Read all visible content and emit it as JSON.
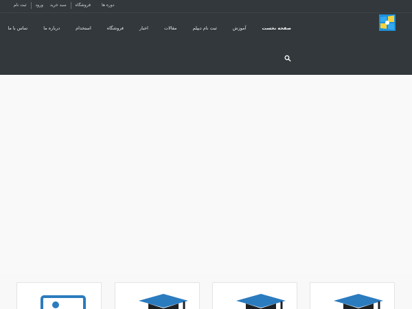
{
  "topbar": {
    "links": [
      "ثبت نام",
      "ورود",
      "سبد خرید",
      "فروشگاه",
      "دوره ها"
    ]
  },
  "nav": {
    "items": [
      {
        "label": "صفحه نخست",
        "active": true
      },
      {
        "label": "آموزش"
      },
      {
        "label": "ثبت نام دیپلم"
      },
      {
        "label": "مقالات"
      },
      {
        "label": "اخبار"
      },
      {
        "label": "فروشگاه"
      },
      {
        "label": "استخدام"
      },
      {
        "label": "درباره ما"
      },
      {
        "label": "تماس با ما"
      }
    ]
  },
  "icons": {
    "logo": "windows-logo-icon",
    "search": "search-icon",
    "cards": [
      "graduation-cap-icon",
      "graduation-cap-icon",
      "graduation-cap-icon",
      "presentation-board-icon"
    ]
  },
  "colors": {
    "header_bg": "#32383b",
    "accent_blue": "#2b7bbf",
    "page_bg": "#f8f8f8"
  }
}
